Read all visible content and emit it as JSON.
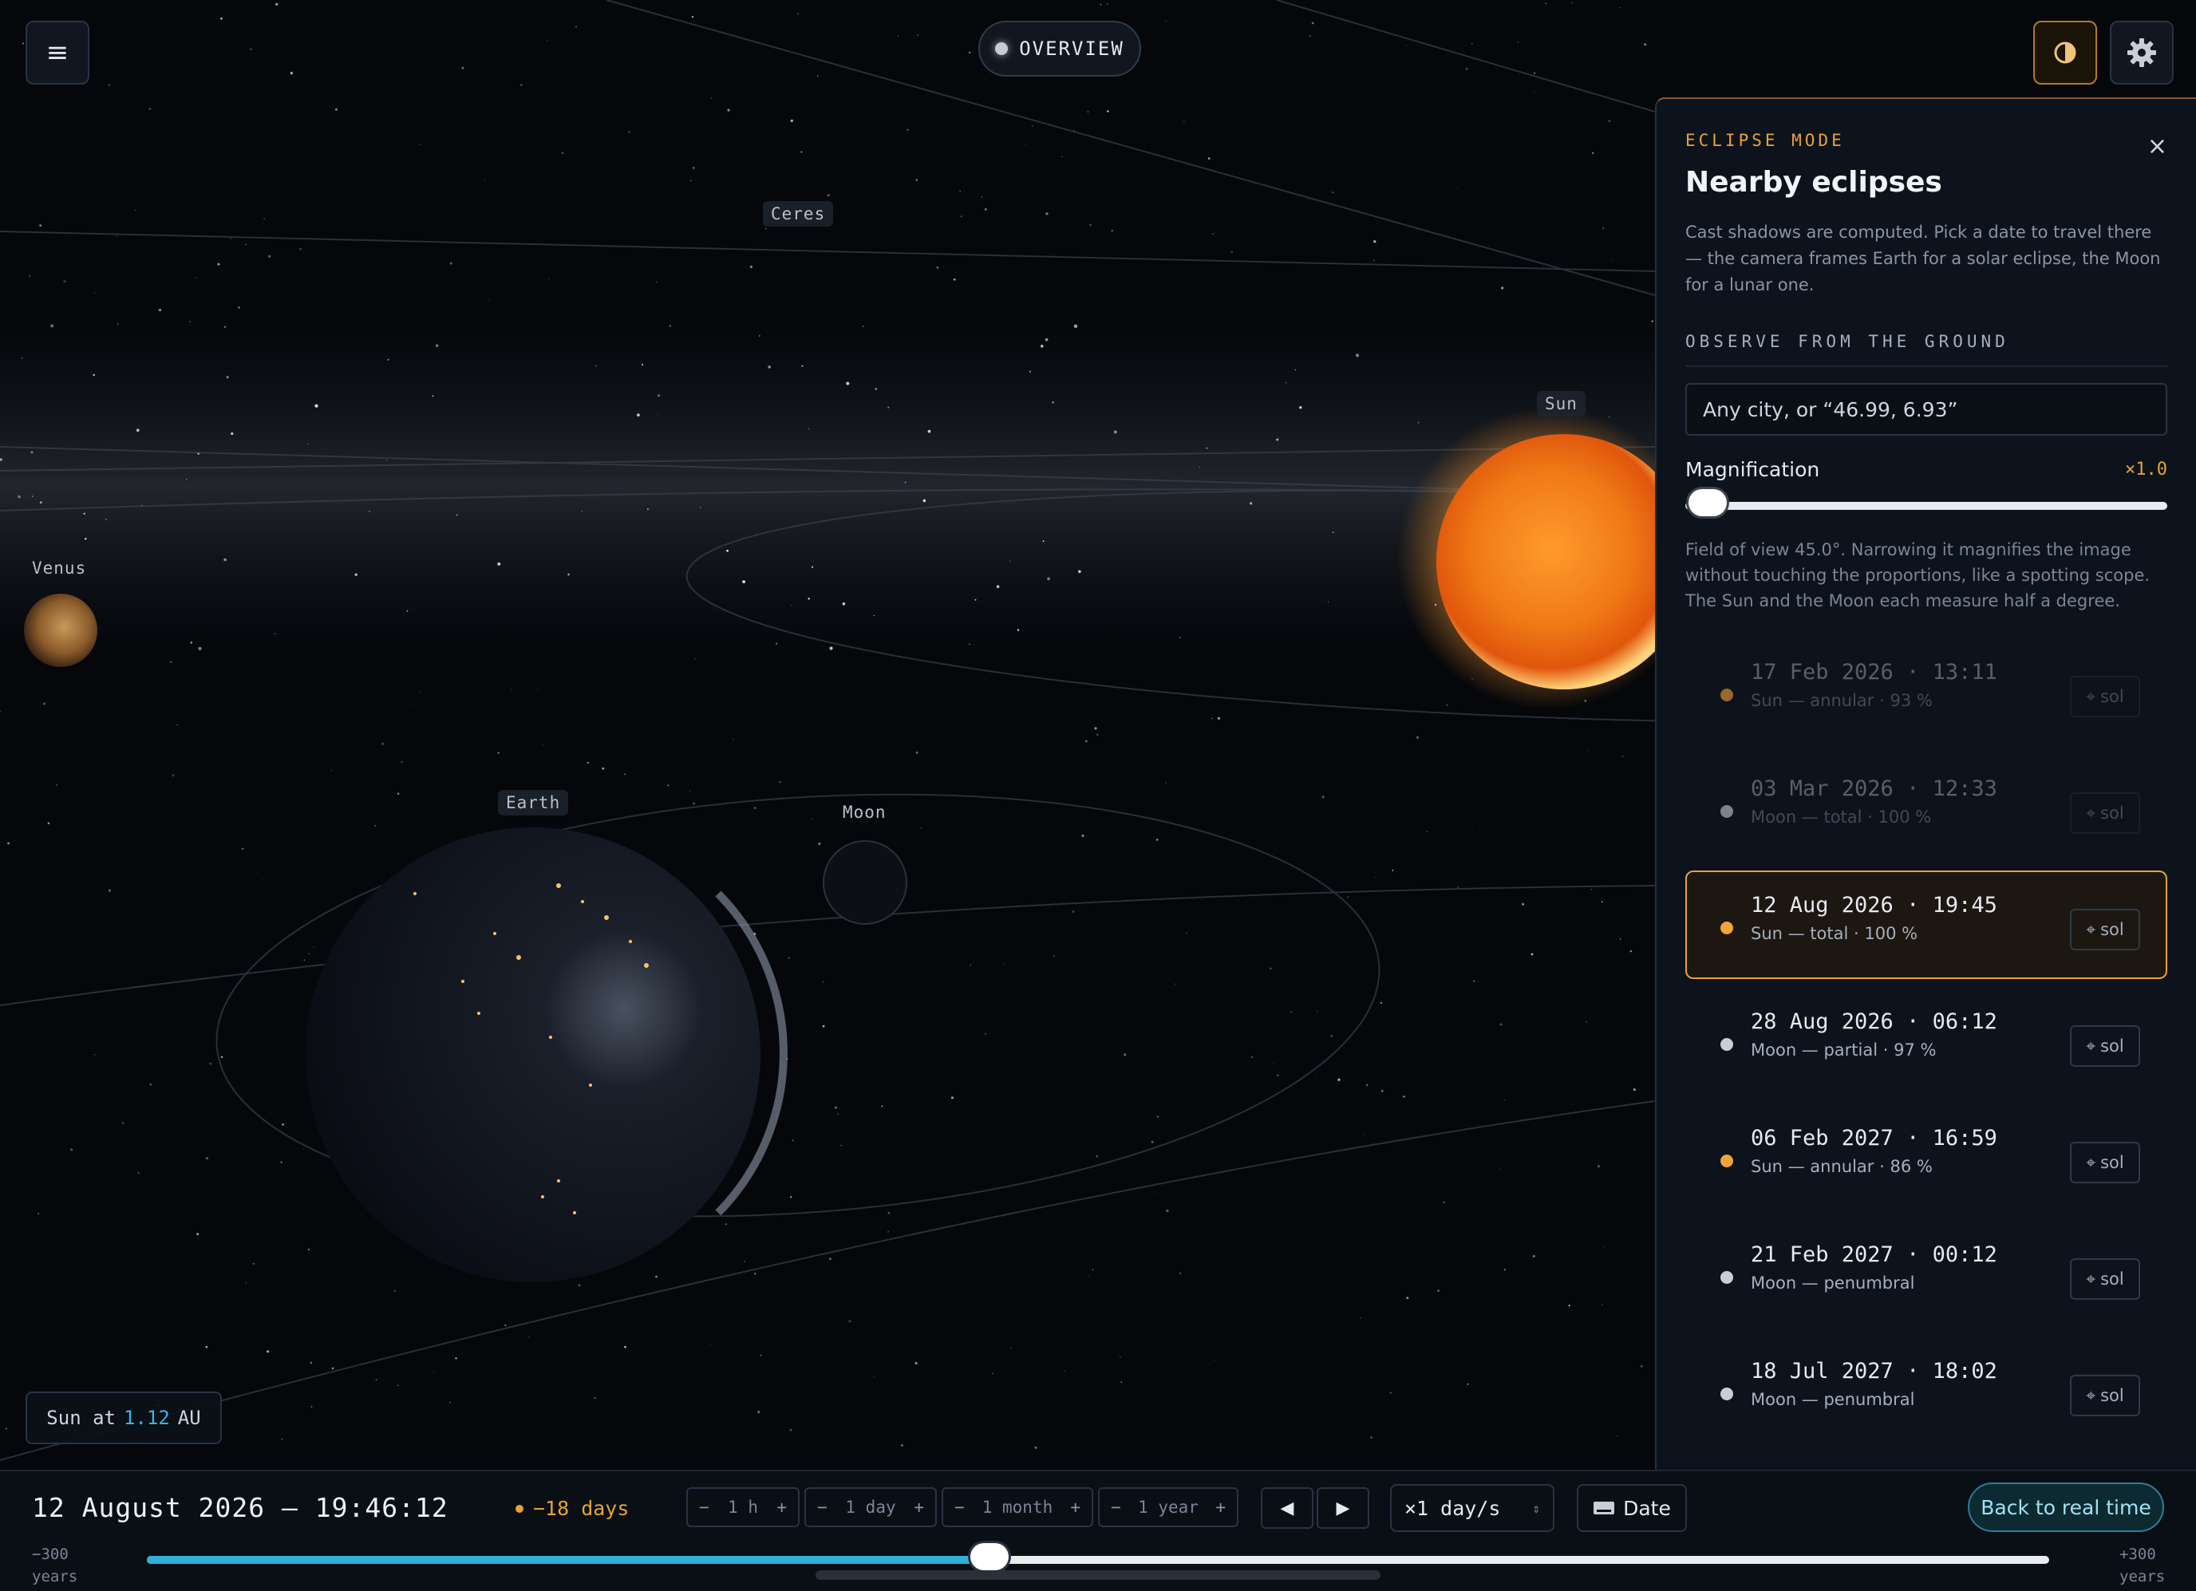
{
  "top": {
    "menu_icon": "hamburger-icon",
    "view_button": "OVERVIEW",
    "contrast_icon": "half-circle-icon",
    "settings_icon": "gear-icon"
  },
  "scene": {
    "labels": {
      "ceres": "Ceres",
      "venus": "Venus",
      "sun": "Sun",
      "earth": "Earth",
      "moon": "Moon"
    },
    "sun_distance": {
      "prefix": "Sun at",
      "value": "1.12",
      "unit": "AU"
    }
  },
  "panel": {
    "kicker": "ECLIPSE MODE",
    "close_label": "×",
    "title": "Nearby eclipses",
    "description": "Cast shadows are computed. Pick a date to travel there — the camera frames Earth for a solar eclipse, the Moon for a lunar one.",
    "observe_heading": "OBSERVE FROM THE GROUND",
    "city_placeholder": "Any city, or “46.99, 6.93”",
    "magnification": {
      "label": "Magnification",
      "value": "×1.0",
      "level": 0
    },
    "fov_note": "Field of view 45.0°. Narrowing it magnifies the image without touching the proportions, like a spotting scope. The Sun and the Moon each measure half a degree.",
    "colors": {
      "solar": "#f2a33a",
      "lunar": "#c9ced6",
      "accent": "#e8a23a"
    },
    "eclipses": [
      {
        "date": "17 Feb 2026 · 13:11",
        "desc": "Sun — annular · 93 %",
        "kind": "solar",
        "state": "past",
        "action": "sol"
      },
      {
        "date": "03 Mar 2026 · 12:33",
        "desc": "Moon — total · 100 %",
        "kind": "lunar",
        "state": "past",
        "action": "sol"
      },
      {
        "date": "12 Aug 2026 · 19:45",
        "desc": "Sun — total · 100 %",
        "kind": "solar",
        "state": "selected",
        "action": "sol"
      },
      {
        "date": "28 Aug 2026 · 06:12",
        "desc": "Moon — partial · 97 %",
        "kind": "lunar",
        "state": "future",
        "action": "sol"
      },
      {
        "date": "06 Feb 2027 · 16:59",
        "desc": "Sun — annular · 86 %",
        "kind": "solar",
        "state": "future",
        "action": "sol"
      },
      {
        "date": "21 Feb 2027 · 00:12",
        "desc": "Moon — penumbral",
        "kind": "lunar",
        "state": "future",
        "action": "sol"
      },
      {
        "date": "18 Jul 2027 · 18:02",
        "desc": "Moon — penumbral",
        "kind": "lunar",
        "state": "future",
        "action": "sol"
      }
    ]
  },
  "bottom": {
    "current_datetime": "12 August 2026 — 19:46:12",
    "delta": "−18 days",
    "steps": [
      {
        "minus": "−",
        "label": "1 h",
        "plus": "+"
      },
      {
        "minus": "−",
        "label": "1 day",
        "plus": "+"
      },
      {
        "minus": "−",
        "label": "1 month",
        "plus": "+"
      },
      {
        "minus": "−",
        "label": "1 year",
        "plus": "+"
      }
    ],
    "prev_icon": "◀",
    "next_icon": "▶",
    "speed": "×1 day/s",
    "date_button": "Date",
    "realtime_button": "Back to real time",
    "range_min": "−300",
    "range_max": "+300",
    "range_unit": "years",
    "timeline_position": 0.443
  }
}
